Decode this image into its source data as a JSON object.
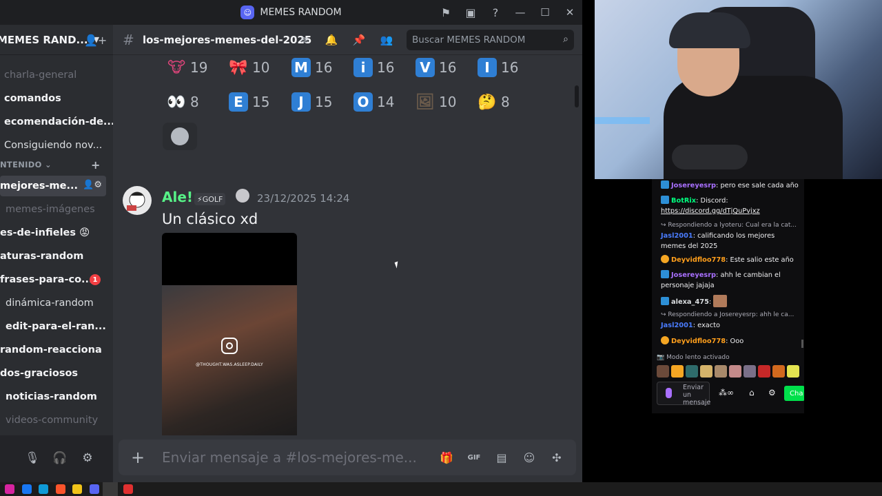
{
  "window": {
    "title": "MEMES RANDOM"
  },
  "server": {
    "name": "MEMES RAND..."
  },
  "sidebar": {
    "channels_top": [
      {
        "label": "charla-general",
        "style": "muted"
      },
      {
        "label": "comandos",
        "style": "bright"
      },
      {
        "label": "ecomendación-de...",
        "style": "bright"
      },
      {
        "label": "Consiguiendo nov...",
        "style": "normal"
      }
    ],
    "category": "NTENIDO",
    "channels": [
      {
        "label": "mejores-me...",
        "style": "active"
      },
      {
        "label": "memes-imágenes",
        "style": "muted"
      },
      {
        "label": "es-de-infieles 😡",
        "style": "bright"
      },
      {
        "label": "aturas-random",
        "style": "bright"
      },
      {
        "label": "frases-para-co...",
        "style": "bright",
        "badge": "1"
      },
      {
        "label": "dinámica-random",
        "style": "normal"
      },
      {
        "label": "edit-para-el-ran...",
        "style": "bright"
      },
      {
        "label": "random-reacciona",
        "style": "bright"
      },
      {
        "label": "dos-graciosos",
        "style": "bright"
      },
      {
        "label": "noticias-random",
        "style": "bright"
      },
      {
        "label": "videos-community",
        "style": "muted"
      }
    ]
  },
  "channel": {
    "name": "los-mejores-memes-del-2025",
    "search_placeholder": "Buscar MEMES RANDOM"
  },
  "reactions_row1": [
    {
      "emoji": "🐮",
      "count": "19",
      "kind": "emoji",
      "color": "#e0457b"
    },
    {
      "emoji": "🎀",
      "count": "10",
      "kind": "emoji",
      "color": "#f49ab8"
    },
    {
      "emoji": "M",
      "count": "16",
      "kind": "letter"
    },
    {
      "emoji": "i",
      "count": "16",
      "kind": "letter"
    },
    {
      "emoji": "V",
      "count": "16",
      "kind": "letter"
    },
    {
      "emoji": "I",
      "count": "16",
      "kind": "letter"
    }
  ],
  "reactions_row2": [
    {
      "emoji": "👀",
      "count": "8",
      "kind": "emoji",
      "color": "#ffffff"
    },
    {
      "emoji": "E",
      "count": "15",
      "kind": "letter"
    },
    {
      "emoji": "J",
      "count": "15",
      "kind": "letter"
    },
    {
      "emoji": "O",
      "count": "14",
      "kind": "letter"
    },
    {
      "emoji": "🖼",
      "count": "10",
      "kind": "emoji",
      "color": "#6b5b4b"
    },
    {
      "emoji": "🤔",
      "count": "8",
      "kind": "emoji",
      "color": "#f7c948"
    }
  ],
  "message": {
    "author": "Ale!",
    "tag": "⚡GOLF",
    "timestamp": "23/12/2025 14:24",
    "text": "Un clásico xd",
    "video_watermark": "@THOUGHT.WAS.ASLEEP.DAILY"
  },
  "composer": {
    "placeholder": "Enviar mensaje a #los-mejores-me..."
  },
  "twitch_chat": {
    "lines": [
      {
        "user": "Josereyesrp",
        "user_color": "#a970ff",
        "badge": "blue",
        "text": ": pero ese sale cada año"
      },
      {
        "user": "BotRix",
        "user_color": "#00ff7f",
        "badge": "blue",
        "text": ": Discord: ",
        "link": "https://discord.gg/dTjQuPvjxz"
      },
      {
        "reply": "↪ Respondiendo a lyoteru: Cual era la cat...",
        "user": "Jasl2001",
        "user_color": "#4a7cff",
        "text": ": calificando los mejores memes del 2025"
      },
      {
        "user": "Deyvidfloo778",
        "user_color": "#ff9f1c",
        "badge": "orange",
        "text": ": Este salio este año"
      },
      {
        "user": "Josereyesrp",
        "user_color": "#a970ff",
        "badge": "blue",
        "text": ": ahh le cambian el personaje jajaja"
      },
      {
        "user": "alexa_475",
        "user_color": "#dbdee1",
        "badge": "blue",
        "text": ": "
      },
      {
        "reply": "↪ Respondiendo a Josereyesrp: ahh le ca...",
        "user": "Jasl2001",
        "user_color": "#4a7cff",
        "text": ": exacto"
      },
      {
        "user": "Deyvidfloo778",
        "user_color": "#ff9f1c",
        "badge": "orange",
        "text": ": Ooo"
      }
    ],
    "slow_mode": "Modo lento activado",
    "input_placeholder": "Enviar un mensaje",
    "chat_button": "Cha"
  }
}
